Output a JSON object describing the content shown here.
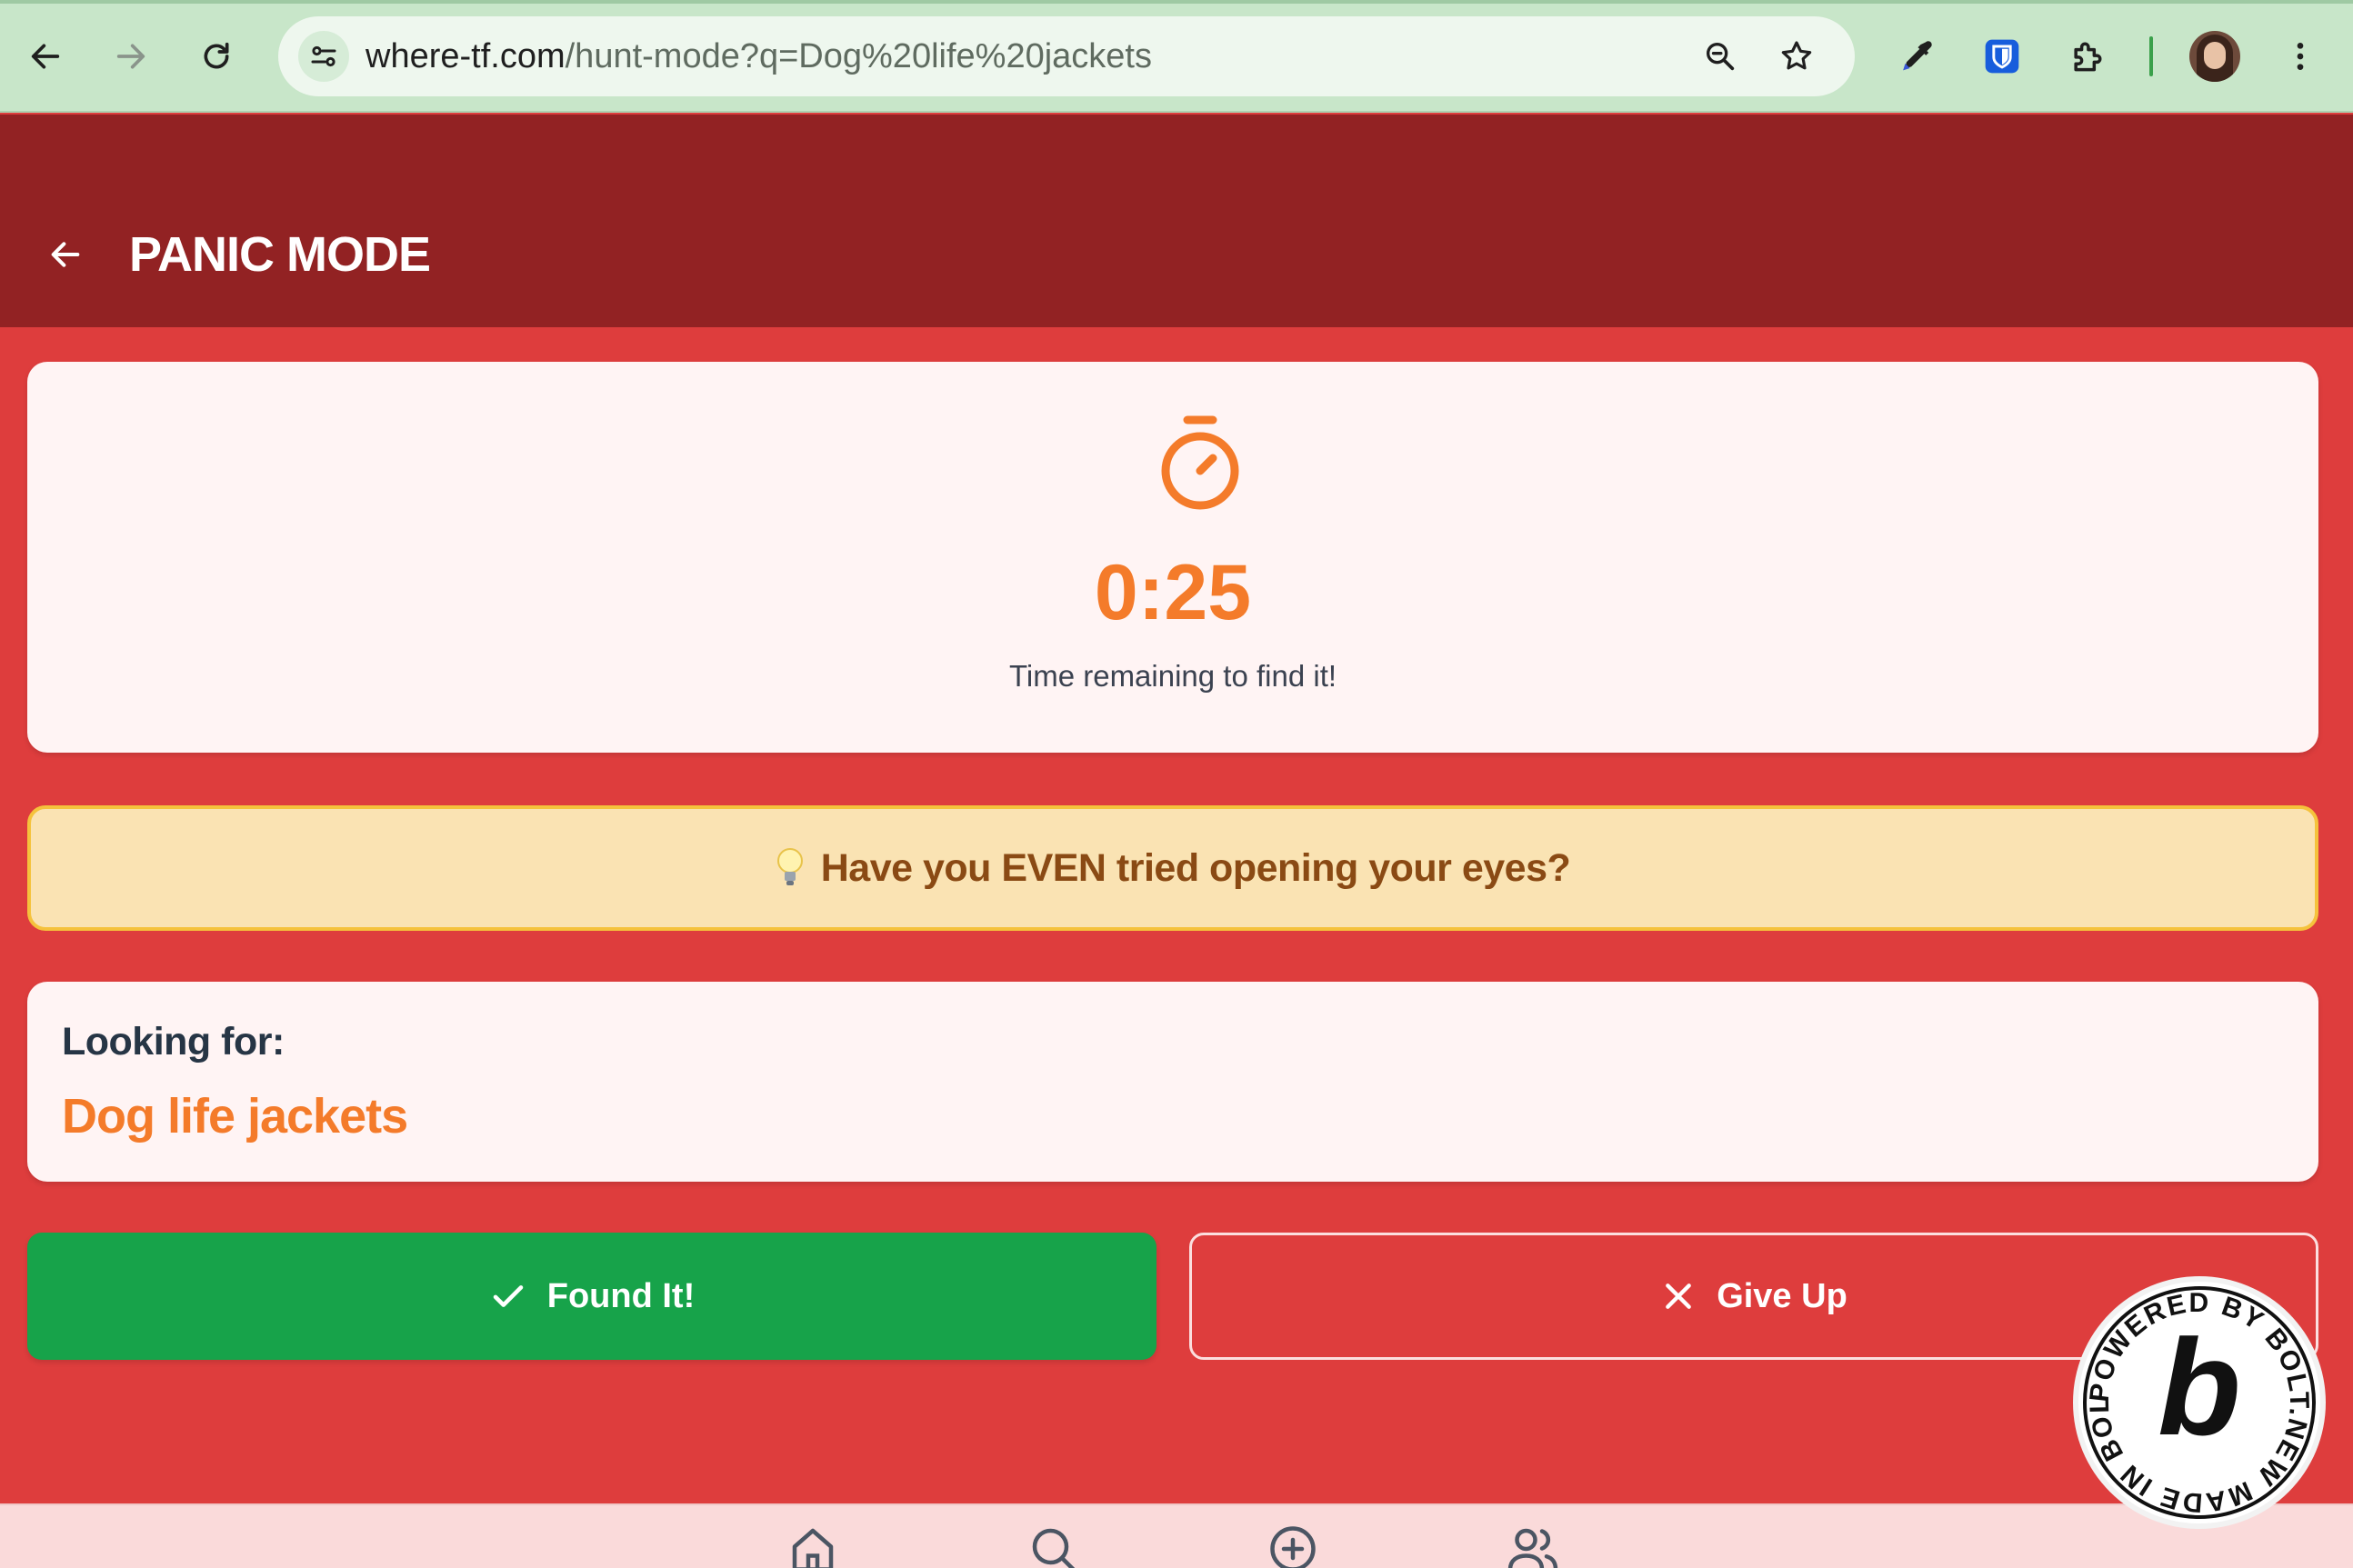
{
  "browser": {
    "url_host": "where-tf.com",
    "url_path": "/hunt-mode?q=Dog%20life%20jackets",
    "icons": [
      "back-arrow-icon",
      "forward-arrow-icon",
      "reload-icon",
      "site-settings-icon",
      "zoom-icon",
      "bookmark-star-icon",
      "eyedropper-icon",
      "bitwarden-shield-icon",
      "extensions-puzzle-icon",
      "profile-avatar",
      "more-vert-icon"
    ]
  },
  "header": {
    "title": "PANIC MODE",
    "bg_color": "#922223"
  },
  "timer": {
    "time": "0:25",
    "subtitle": "Time remaining to find it!",
    "icon": "stopwatch-icon",
    "color": "#f47b2a"
  },
  "hint": {
    "icon": "lightbulb-icon",
    "text": "Have you EVEN tried opening your eyes?"
  },
  "target": {
    "label": "Looking for:",
    "item": "Dog life jackets"
  },
  "actions": {
    "found_label": "Found It!",
    "found_icon": "check-icon",
    "found_color": "#17a34a",
    "giveup_label": "Give Up",
    "giveup_icon": "close-icon"
  },
  "bottom_nav": {
    "items": [
      "home-icon",
      "search-icon",
      "add-circle-icon",
      "users-icon"
    ]
  },
  "badge": {
    "text": "POWERED BY BOLT.NEW MADE IN BOLT.NEW",
    "letter": "b"
  },
  "colors": {
    "page_bg": "#de3d3d",
    "card_bg": "#fff4f4",
    "hint_bg": "#fae3b3",
    "hint_border": "#f5c23c",
    "hint_text": "#8a4a14"
  }
}
